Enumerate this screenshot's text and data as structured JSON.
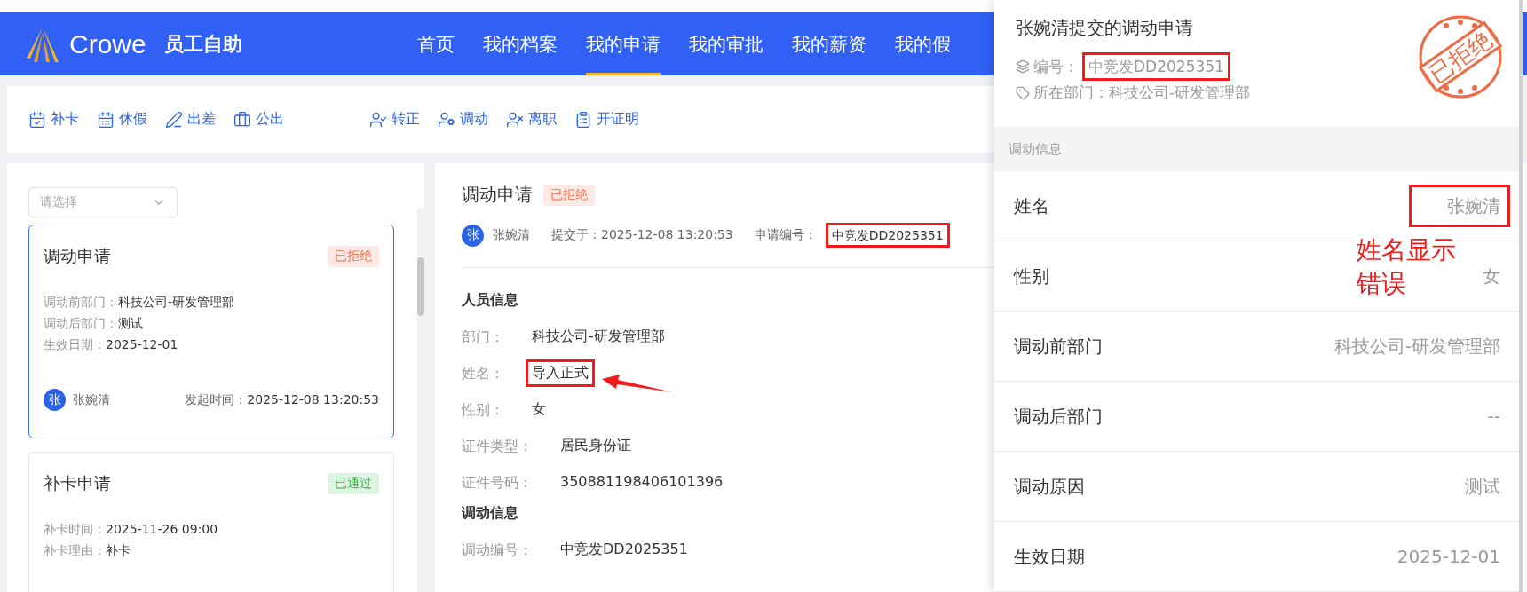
{
  "header": {
    "logo": "Crowe",
    "app_title": "员工自助",
    "nav": [
      {
        "label": "首页",
        "selected": false
      },
      {
        "label": "我的档案",
        "selected": false
      },
      {
        "label": "我的申请",
        "selected": true
      },
      {
        "label": "我的审批",
        "selected": false
      },
      {
        "label": "我的薪资",
        "selected": false
      },
      {
        "label": "我的假",
        "selected": false
      }
    ]
  },
  "toolbar": {
    "groups": [
      [
        {
          "label": "补卡"
        },
        {
          "label": "休假"
        },
        {
          "label": "出差"
        },
        {
          "label": "公出"
        }
      ],
      [
        {
          "label": "转正"
        },
        {
          "label": "调动"
        },
        {
          "label": "离职"
        },
        {
          "label": "开证明"
        }
      ]
    ]
  },
  "filter": {
    "placeholder": "请选择"
  },
  "cards": [
    {
      "title": "调动申请",
      "selected": true,
      "status": {
        "label": "已拒绝",
        "color": "#f5694a"
      },
      "fields": [
        {
          "label": "调动前部门：",
          "value": "科技公司-研发管理部"
        },
        {
          "label": "调动后部门：",
          "value": "测试"
        },
        {
          "label": "生效日期：",
          "value": "2025-12-01"
        }
      ],
      "footer": {
        "avatar": "张",
        "name": "张婉清",
        "time_label": "发起时间：",
        "time": "2025-12-08 13:20:53"
      }
    },
    {
      "title": "补卡申请",
      "selected": false,
      "status": {
        "label": "已通过",
        "color": "#2fb24a"
      },
      "fields": [
        {
          "label": "补卡时间：",
          "value": "2025-11-26 09:00"
        },
        {
          "label": "补卡理由：",
          "value": "补卡"
        }
      ]
    }
  ],
  "detail": {
    "title": "调动申请",
    "status": {
      "label": "已拒绝",
      "color": "#f5694a"
    },
    "avatar": "张",
    "applicant": "张婉清",
    "submitted_label": "提交于：",
    "submitted": "2025-12-08 13:20:53",
    "number_label": "申请编号：",
    "number": "中竞发DD2025351",
    "number_flagged": true,
    "sections": [
      {
        "heading": "人员信息",
        "rows": [
          {
            "label": "部门：",
            "value": "科技公司-研发管理部",
            "flagged": false
          },
          {
            "label": "姓名：",
            "value": "导入正式",
            "flagged": true
          },
          {
            "label": "性别：",
            "value": "女",
            "flagged": false
          },
          {
            "label": "证件类型：",
            "value": "居民身份证",
            "flagged": false
          },
          {
            "label": "证件号码：",
            "value": "350881198406101396",
            "flagged": false
          }
        ]
      },
      {
        "heading": "调动信息",
        "rows": [
          {
            "label": "调动编号：",
            "value": "中竞发DD2025351",
            "flagged": false
          }
        ]
      }
    ]
  },
  "drawer": {
    "title": "张婉清提交的调动申请",
    "number_label": "编号：",
    "number": "中竞发DD2025351",
    "number_flagged": true,
    "dept_label": "所在部门：",
    "dept": "科技公司-研发管理部",
    "stamp": "已拒绝",
    "section": "调动信息",
    "rows": [
      {
        "label": "姓名",
        "value": "张婉清",
        "flagged": true
      },
      {
        "label": "性别",
        "value": "女",
        "flagged": false
      },
      {
        "label": "调动前部门",
        "value": "科技公司-研发管理部",
        "flagged": false
      },
      {
        "label": "调动后部门",
        "value": "--",
        "flagged": false
      },
      {
        "label": "调动原因",
        "value": "测试",
        "flagged": false
      },
      {
        "label": "生效日期",
        "value": "2025-12-01",
        "flagged": false
      }
    ],
    "note": "姓名显示错误"
  }
}
